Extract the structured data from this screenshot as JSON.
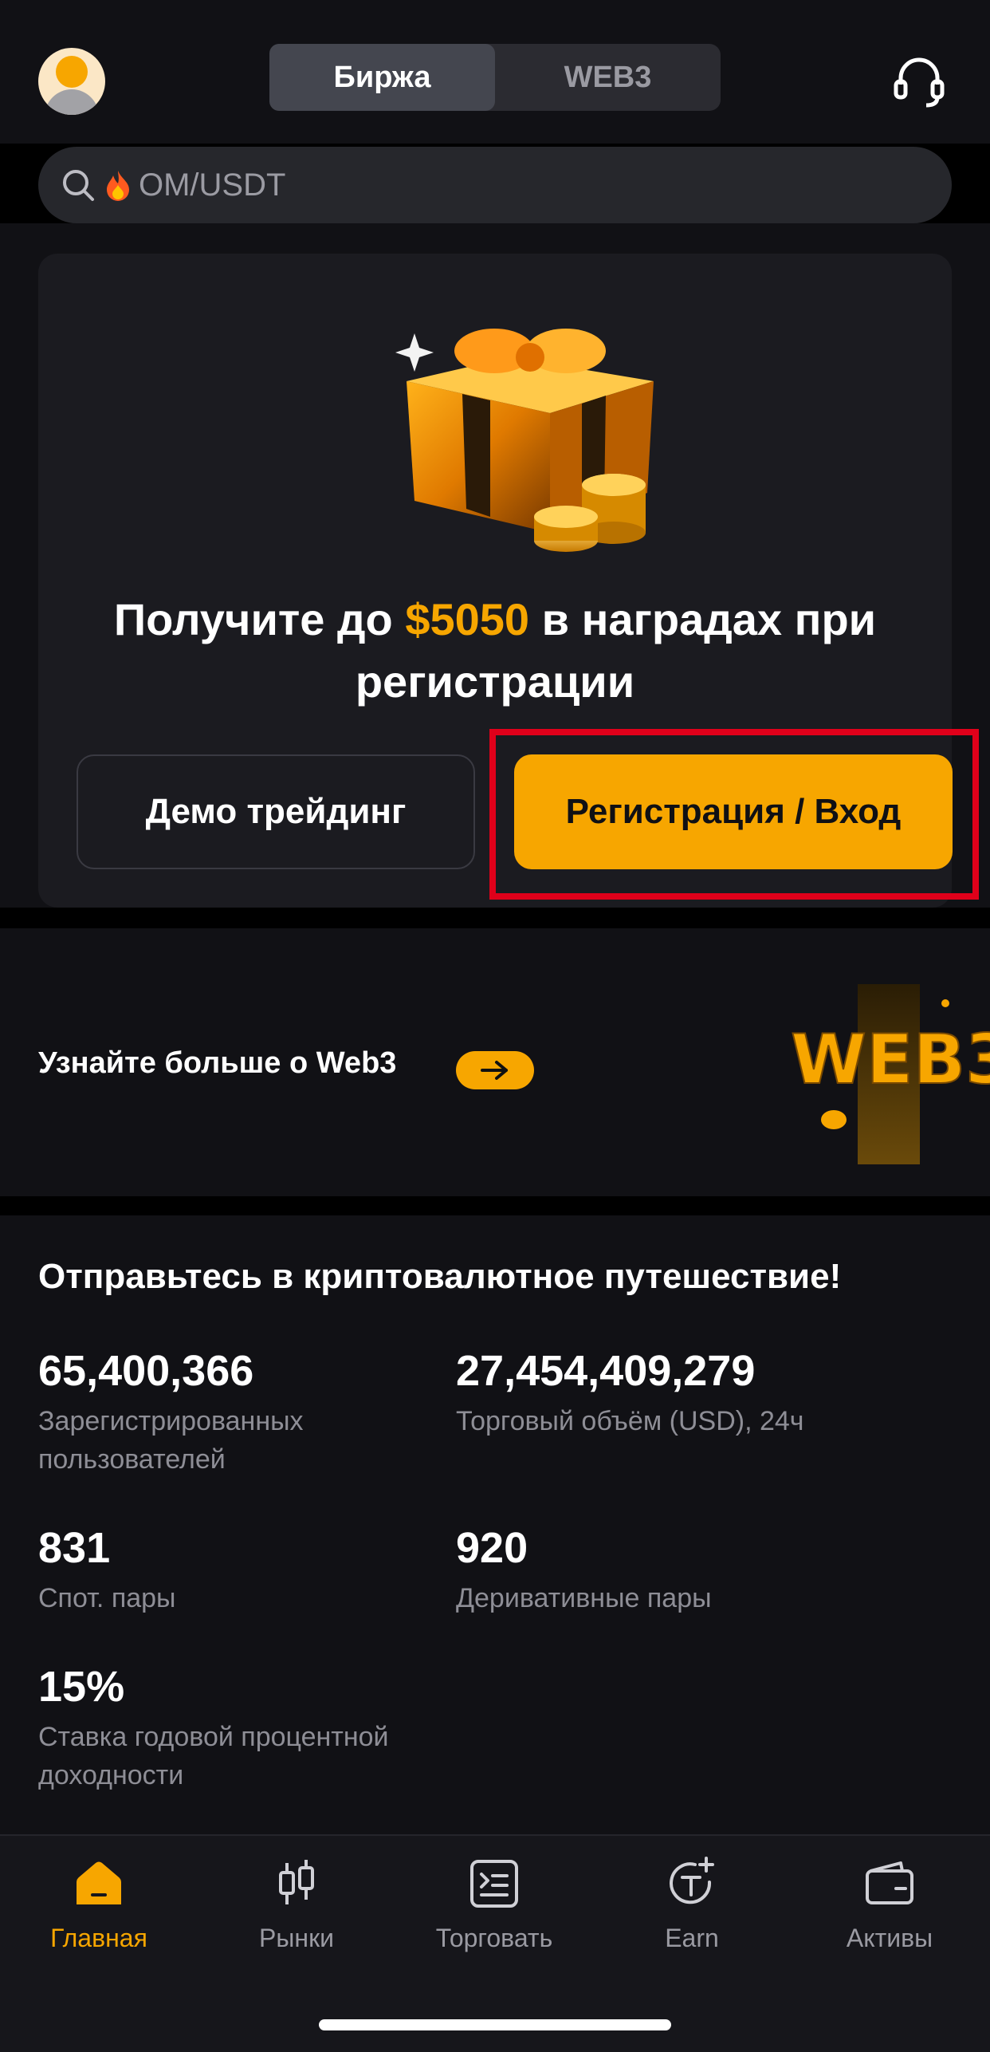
{
  "header": {
    "tabs": [
      "Биржа",
      "WEB3"
    ],
    "active_tab": 0
  },
  "search": {
    "placeholder": "OM/USDT",
    "hot_icon": "fire-icon"
  },
  "hero": {
    "title_prefix": "Получите до ",
    "title_amount": "$5050",
    "title_suffix": " в наградах при регистрации",
    "demo_button": "Демо трейдинг",
    "register_button": "Регистрация / Вход"
  },
  "web3_banner": {
    "text": "Узнайте больше о Web3",
    "art_text": "WEB3"
  },
  "stats": {
    "title": "Отправьтесь в криптовалютное путешествие!",
    "items": [
      {
        "value": "65,400,366",
        "label": "Зарегистрированных пользователей"
      },
      {
        "value": "27,454,409,279",
        "label": "Торговый объём (USD), 24ч"
      },
      {
        "value": "831",
        "label": "Спот. пары"
      },
      {
        "value": "920",
        "label": "Деривативные пары"
      },
      {
        "value": "15%",
        "label": "Ставка годовой процентной доходности"
      }
    ]
  },
  "tabbar": {
    "items": [
      {
        "label": "Главная",
        "icon": "home-icon",
        "active": true
      },
      {
        "label": "Рынки",
        "icon": "candlestick-icon",
        "active": false
      },
      {
        "label": "Торговать",
        "icon": "trade-icon",
        "active": false
      },
      {
        "label": "Earn",
        "icon": "earn-icon",
        "active": false
      },
      {
        "label": "Активы",
        "icon": "wallet-icon",
        "active": false
      }
    ]
  },
  "colors": {
    "accent": "#f7a600",
    "background": "#111115",
    "card": "#1b1b20",
    "highlight_border": "#e0001a"
  }
}
